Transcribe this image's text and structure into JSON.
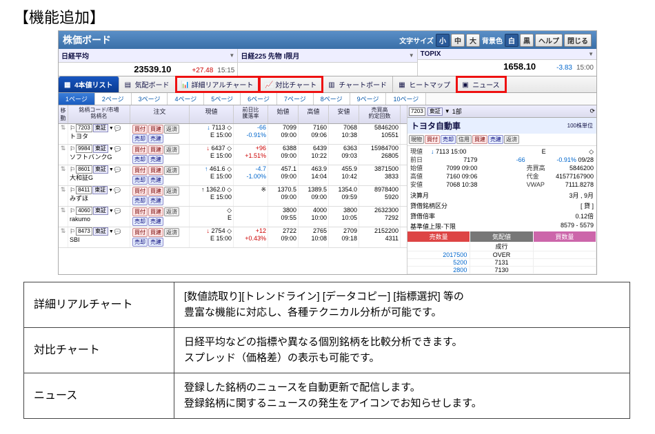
{
  "header_label": "【機能追加】",
  "titlebar": {
    "title": "株価ボード",
    "font_size_label": "文字サイズ",
    "size_small": "小",
    "size_mid": "中",
    "size_large": "大",
    "bg_label": "背景色",
    "bg_white": "白",
    "bg_black": "黒",
    "help": "ヘルプ",
    "close": "閉じる"
  },
  "indices": [
    {
      "name": "日経平均",
      "price": "23539.10",
      "diff": "+27.48",
      "dir": "up",
      "time": "15:15"
    },
    {
      "name": "日経225 先物 I限月",
      "price": "",
      "diff": "",
      "dir": "",
      "time": ""
    },
    {
      "name": "TOPIX",
      "price": "1658.10",
      "diff": "-3.83",
      "dir": "down",
      "time": "15:00"
    }
  ],
  "tabs": {
    "t1": "4本値リスト",
    "t2": "気配ボード",
    "t3": "詳細リアルチャート",
    "t4": "対比チャート",
    "t5": "チャートボード",
    "t6": "ヒートマップ",
    "t7": "ニュース"
  },
  "pages": [
    "1ページ",
    "2ページ",
    "3ページ",
    "4ページ",
    "5ページ",
    "6ページ",
    "7ページ",
    "8ページ",
    "9ページ",
    "10ページ"
  ],
  "grid_head": {
    "move": "移動",
    "code": "銘柄コード/市場\n銘柄名",
    "order": "注文",
    "cur": "現値",
    "diff": "前日比\n騰落率",
    "open": "始値",
    "high": "高値",
    "low": "安値",
    "vol": "売買高\n約定回数"
  },
  "order_btns": {
    "buy": "買付",
    "tbuy": "買建",
    "repay": "返済",
    "sell": "売却",
    "tsell": "売建"
  },
  "rows": [
    {
      "code": "7203",
      "mkt": "東証",
      "name": "トヨタ",
      "a": "↓",
      "cur": "7113",
      "e": "15:00",
      "d": "-66",
      "dp": "-0.91%",
      "dc": "down",
      "open": "7099",
      "ot": "09:00",
      "high": "7160",
      "ht": "09:06",
      "low": "7068",
      "lt": "10:38",
      "vol": "5846200",
      "cnt": "10551"
    },
    {
      "code": "9984",
      "mkt": "東証",
      "name": "ソフトバンクG",
      "a": "↓",
      "cur": "6437",
      "e": "15:00",
      "d": "+96",
      "dp": "+1.51%",
      "dc": "up",
      "open": "6388",
      "ot": "09:00",
      "high": "6439",
      "ht": "10:22",
      "low": "6363",
      "lt": "09:03",
      "vol": "15984700",
      "cnt": "26805"
    },
    {
      "code": "8601",
      "mkt": "東証",
      "name": "大和証G",
      "a": "↑",
      "cur": "461.6",
      "e": "15:00",
      "d": "-4.7",
      "dp": "-1.00%",
      "dc": "down",
      "open": "457.1",
      "ot": "09:00",
      "high": "463.9",
      "ht": "14:04",
      "low": "455.9",
      "lt": "10:42",
      "vol": "3871500",
      "cnt": "3833"
    },
    {
      "code": "8411",
      "mkt": "東証",
      "name": "みずほ",
      "a": "↑",
      "cur": "1362.0",
      "e": "15:00",
      "d": "※",
      "dp": "",
      "dc": "",
      "open": "1370.5",
      "ot": "09:00",
      "high": "1389.5",
      "ht": "09:00",
      "low": "1354.0",
      "lt": "09:59",
      "vol": "8978400",
      "cnt": "5920"
    },
    {
      "code": "4060",
      "mkt": "東証",
      "name": "rakumo",
      "a": "",
      "cur": "",
      "e": "",
      "d": "",
      "dp": "",
      "dc": "",
      "open": "3800",
      "ot": "09:55",
      "high": "4000",
      "ht": "10:00",
      "low": "3800",
      "lt": "10:05",
      "vol": "2632300",
      "cnt": "7292"
    },
    {
      "code": "8473",
      "mkt": "東証",
      "name": "SBI",
      "a": "↓",
      "cur": "2754",
      "e": "15:00",
      "d": "+12",
      "dp": "+0.43%",
      "dc": "up",
      "open": "2722",
      "ot": "09:00",
      "high": "2765",
      "ht": "10:08",
      "low": "2709",
      "lt": "09:18",
      "vol": "2152200",
      "cnt": "4311"
    }
  ],
  "side": {
    "pill_code": "7203",
    "pill_mkt": "東証",
    "pill_sec": "1部",
    "title": "トヨタ自動車",
    "unit": "100株単位",
    "btns": {
      "spot": "現物",
      "buy": "買付",
      "sell": "売却",
      "margin": "信用",
      "tbuy": "買建",
      "tsell": "売建",
      "repay": "返済"
    },
    "stats": {
      "cur_l": "現値",
      "cur": "7113",
      "cur_t": "15:00",
      "E": "E",
      "sym": "◇",
      "prev_l": "前日",
      "prev": "7179",
      "prev_diff": "-66",
      "prev_dp": "-0.91%",
      "prev_date": "09/28",
      "open_l": "始値",
      "open": "7099",
      "open_t": "09:00",
      "vol_l": "売買高",
      "vol": "5846200",
      "high_l": "高値",
      "high": "7160",
      "high_t": "09:06",
      "amt_l": "代金",
      "amt": "41577167900",
      "low_l": "安値",
      "low": "7068",
      "low_t": "10:38",
      "vwap_l": "VWAP",
      "vwap": "7111.8278",
      "settle_l": "決算月",
      "settle": "3月 , 9月",
      "kubun_l": "貸借銘柄区分",
      "kubun": "[ 貸 ]",
      "ratio_l": "貸借倍率",
      "ratio": "0.12倍",
      "limit_l": "基準値上限-下限",
      "limit": "8579 -    5579"
    },
    "board_head": {
      "sell": "売数量",
      "price": "気配値",
      "buy": "買数量"
    },
    "board_rows": [
      {
        "s": "",
        "p": "成行",
        "b": ""
      },
      {
        "s": "2017500",
        "p": "OVER",
        "b": ""
      },
      {
        "s": "5200",
        "p": "7131",
        "b": ""
      },
      {
        "s": "2800",
        "p": "7130",
        "b": ""
      }
    ]
  },
  "desc": [
    {
      "t": "詳細リアルチャート",
      "d": "[数値読取り][トレンドライン] [データコピー] [指標選択] 等の\n豊富な機能に対応し、各種テクニカル分析が可能です。"
    },
    {
      "t": "対比チャート",
      "d": "日経平均などの指標や異なる個別銘柄を比較分析できます。\nスプレッド（価格差）の表示も可能です。"
    },
    {
      "t": "ニュース",
      "d": "登録した銘柄のニュースを自動更新で配信します。\n登録銘柄に関するニュースの発生をアイコンでお知らせします。"
    }
  ]
}
